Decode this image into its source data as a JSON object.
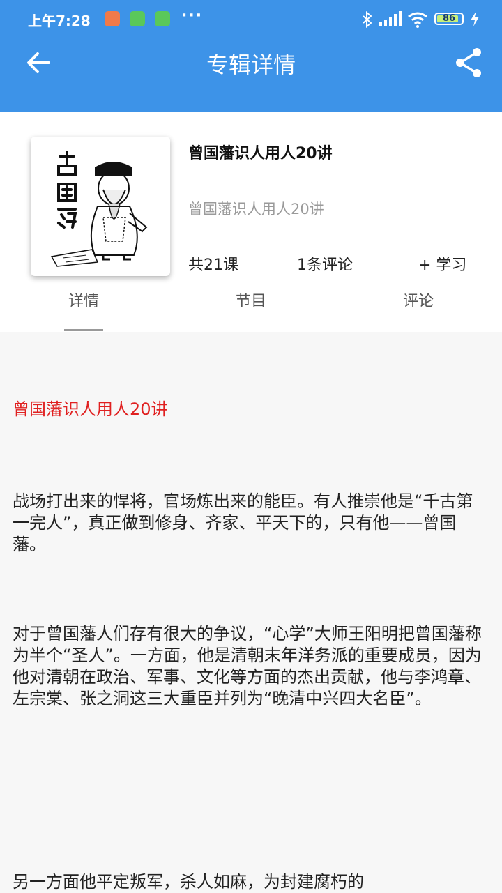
{
  "status_bar": {
    "time": "上午7:28",
    "battery": "86"
  },
  "toolbar": {
    "title": "专辑详情"
  },
  "album": {
    "title": "曾国藩识人用人20讲",
    "subtitle": "曾国藩识人用人20讲",
    "lesson_count": "共21课",
    "comment_count": "1条评论",
    "study_label": "+ 学习",
    "cover_caption": "曾國藩"
  },
  "tabs": [
    {
      "label": "详情"
    },
    {
      "label": "节目"
    },
    {
      "label": "评论"
    }
  ],
  "content": {
    "heading": "曾国藩识人用人20讲",
    "paragraphs": [
      "战场打出来的悍将，官场炼出来的能臣。有人推崇他是“千古第一完人”，真正做到修身、齐家、平天下的，只有他——曾国藩。",
      "对于曾国藩人们存有很大的争议，“心学”大师王阳明把曾国藩称为半个“圣人”。一方面，他是清朝末年洋务派的重要成员，因为他对清朝在政治、军事、文化等方面的杰出贡献，他与李鸿章、左宗棠、张之洞这三大重臣并列为“晚清中兴四大名臣”。",
      "另一方面他平定叛军，杀人如麻，为封建腐朽的"
    ]
  },
  "colors": {
    "appbar": "#3d93e8",
    "heading": "#e02020"
  }
}
